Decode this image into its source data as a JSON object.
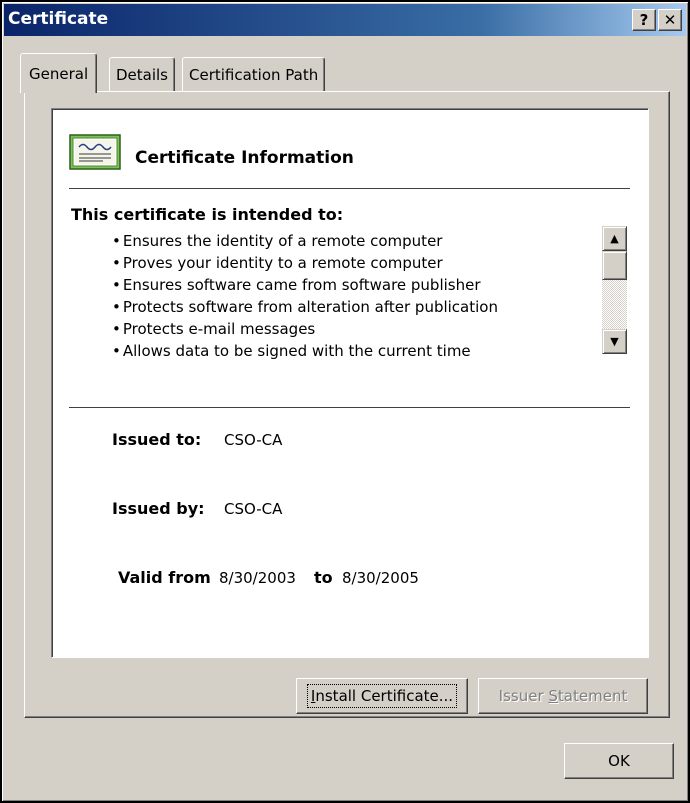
{
  "window": {
    "title": "Certificate",
    "help_label": "?",
    "close_label": "✕"
  },
  "tabs": [
    {
      "label": "General",
      "active": true
    },
    {
      "label": "Details",
      "active": false
    },
    {
      "label": "Certification Path",
      "active": false
    }
  ],
  "info": {
    "heading": "Certificate Information",
    "icon": "certificate-icon",
    "purpose_title": "This certificate is intended to:",
    "purposes": [
      "Ensures the identity of a remote computer",
      "Proves your identity to a remote computer",
      "Ensures software came from software publisher",
      "Protects software from alteration after publication",
      "Protects e-mail messages",
      "Allows data to be signed with the current time"
    ],
    "issued_to_label": "Issued to:",
    "issued_to_value": "CSO-CA",
    "issued_by_label": "Issued by:",
    "issued_by_value": "CSO-CA",
    "valid_from_label": "Valid from",
    "valid_from_value": "8/30/2003",
    "valid_to_label": "to",
    "valid_to_value": "8/30/2005"
  },
  "buttons": {
    "install_prefix": "I",
    "install_rest": "nstall Certificate...",
    "issuer_prefix": "Issuer ",
    "issuer_underline": "S",
    "issuer_rest": "tatement",
    "ok": "OK"
  },
  "colors": {
    "titlebar_start": "#0a246a",
    "titlebar_end": "#a6caf0",
    "face": "#d4d0c8"
  }
}
